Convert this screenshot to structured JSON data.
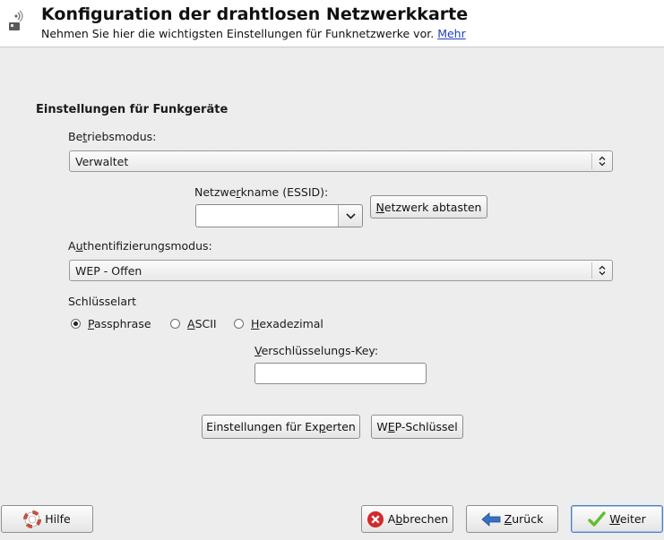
{
  "header": {
    "title": "Konfiguration der drahtlosen Netzwerkkarte",
    "subtitle": "Nehmen Sie hier die wichtigsten Einstellungen für Funknetzwerke vor.",
    "more_link": "Mehr",
    "icon": "wireless-network-card-icon"
  },
  "section": {
    "title": "Einstellungen für Funkgeräte"
  },
  "betriebsmodus": {
    "label_pre": "Be",
    "label_mnemonic": "t",
    "label_post": "riebsmodus:",
    "value": "Verwaltet"
  },
  "essid": {
    "label_pre": "Netzwe",
    "label_mnemonic": "r",
    "label_post": "kname (ESSID):",
    "value": ""
  },
  "scan_button": {
    "label_mnemonic": "N",
    "label_post": "etzwerk abtasten"
  },
  "auth": {
    "label_pre": "A",
    "label_mnemonic": "u",
    "label_post": "thentifizierungsmodus:",
    "value": "WEP - Offen"
  },
  "key_type": {
    "label": "Schlüsselart",
    "options": [
      {
        "pre": "",
        "mnemonic": "P",
        "post": "assphrase",
        "selected": true
      },
      {
        "pre": "",
        "mnemonic": "A",
        "post": "SCII",
        "selected": false
      },
      {
        "pre": "",
        "mnemonic": "H",
        "post": "exadezimal",
        "selected": false
      }
    ]
  },
  "encryption_key": {
    "label_pre": "",
    "label_mnemonic": "V",
    "label_post": "erschlüsselungs-Key:",
    "value": ""
  },
  "expert_button": {
    "label_pre": "Einstellungen für Ex",
    "label_mnemonic": "p",
    "label_post": "erten"
  },
  "wep_button": {
    "label_pre": "W",
    "label_mnemonic": "E",
    "label_post": "P-Schlüssel"
  },
  "footer": {
    "help": "Hilfe",
    "cancel_pre": "A",
    "cancel_mnemonic": "b",
    "cancel_post": "brechen",
    "back_pre": "",
    "back_mnemonic": "Z",
    "back_post": "urück",
    "next_pre": "",
    "next_mnemonic": "W",
    "next_post": "eiter"
  },
  "colors": {
    "link": "#1f3fbf",
    "cancel_icon": "#d42a2a",
    "back_icon": "#3a6fc4",
    "next_icon": "#5fbf2f"
  }
}
